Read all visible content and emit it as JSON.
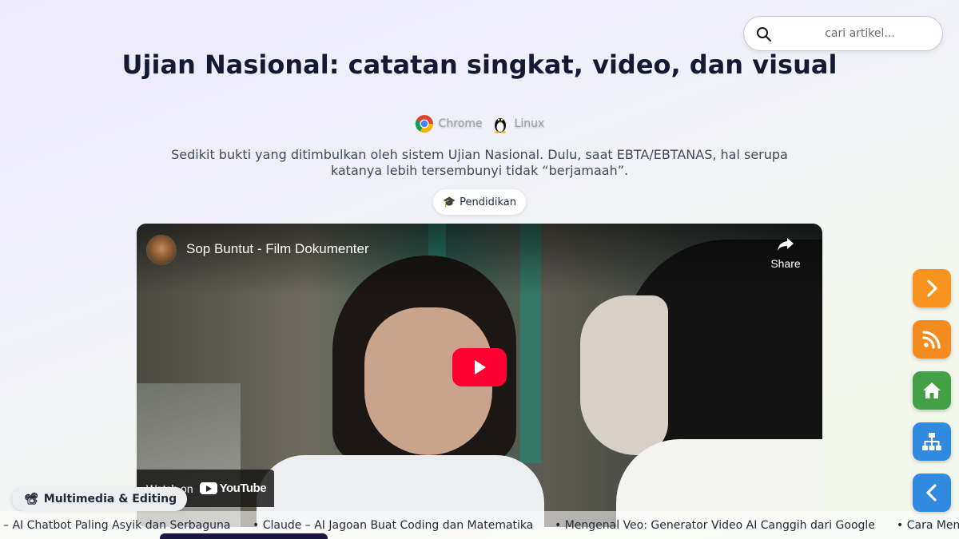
{
  "search": {
    "placeholder": "cari artikel..."
  },
  "article": {
    "title": "Ujian Nasional: catatan singkat, video, dan visual",
    "platforms": [
      {
        "icon": "chrome-icon",
        "label": "Chrome"
      },
      {
        "icon": "linux-tux-icon",
        "label": "Linux"
      }
    ],
    "description": "Sedikit bukti yang ditimbulkan oleh sistem Ujian Nasional. Dulu, saat EBTA/EBTANAS, hal serupa katanya lebih tersembunyi tidak “berjamaah”.",
    "tag": {
      "icon": "graduation-cap-icon",
      "label": "Pendidikan"
    }
  },
  "video": {
    "title": "Sop Buntut - Film Dokumenter",
    "share_label": "Share",
    "watch_on": "Watch on",
    "brand": "YouTube"
  },
  "category_chip": {
    "icon": "film-camera-icon",
    "label": "Multimedia & Editing"
  },
  "ticker": {
    "items": [
      "– AI Chatbot Paling Asyik dan Serbaguna",
      "• Claude – AI Jagoan Buat Coding dan Matematika",
      "• Mengenal Veo: Generator Video AI Canggih dari Google",
      "• Cara Mem"
    ]
  },
  "side_buttons": [
    {
      "name": "next-button",
      "icon": "chevron-right-icon",
      "color": "#f7931e"
    },
    {
      "name": "rss-button",
      "icon": "rss-icon",
      "color": "#f58a1f"
    },
    {
      "name": "home-button",
      "icon": "home-icon",
      "color": "#43a047"
    },
    {
      "name": "sitemap-button",
      "icon": "sitemap-icon",
      "color": "#2f8ae0"
    },
    {
      "name": "prev-button",
      "icon": "chevron-left-icon",
      "color": "#2f8ae0"
    }
  ]
}
